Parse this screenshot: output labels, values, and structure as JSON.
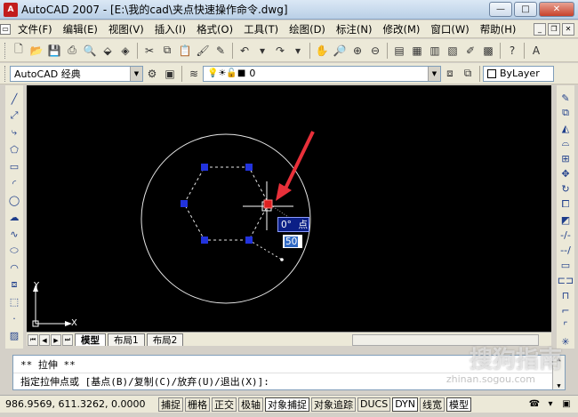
{
  "window": {
    "app_icon_text": "A",
    "title": "AutoCAD 2007 - [E:\\我的cad\\夹点快速操作命令.dwg]",
    "minimize": "—",
    "maximize": "□",
    "close": "✕"
  },
  "menu": {
    "items": [
      {
        "label": "文件(F)"
      },
      {
        "label": "编辑(E)"
      },
      {
        "label": "视图(V)"
      },
      {
        "label": "插入(I)"
      },
      {
        "label": "格式(O)"
      },
      {
        "label": "工具(T)"
      },
      {
        "label": "绘图(D)"
      },
      {
        "label": "标注(N)"
      },
      {
        "label": "修改(M)"
      },
      {
        "label": "窗口(W)"
      },
      {
        "label": "帮助(H)"
      }
    ],
    "mdi_min": "_",
    "mdi_restore": "❐",
    "mdi_close": "✕"
  },
  "toolbar2": {
    "workspace_value": "AutoCAD 经典",
    "layer_value": "0",
    "color_value": "ByLayer"
  },
  "canvas": {
    "dyn_angle": "0°",
    "dyn_point_hint": "点",
    "dyn_input_value": "50",
    "ucs_y": "Y",
    "ucs_x": "X"
  },
  "layout_tabs": [
    {
      "label": "模型",
      "active": true
    },
    {
      "label": "布局1",
      "active": false
    },
    {
      "label": "布局2",
      "active": false
    }
  ],
  "command": {
    "line1": "** 拉伸 **",
    "line2": "指定拉伸点或 [基点(B)/复制(C)/放弃(U)/退出(X)]:"
  },
  "status": {
    "coords": "986.9569,  611.3262, 0.0000",
    "buttons": [
      {
        "label": "捕捉",
        "on": false
      },
      {
        "label": "栅格",
        "on": false
      },
      {
        "label": "正交",
        "on": false
      },
      {
        "label": "极轴",
        "on": false
      },
      {
        "label": "对象捕捉",
        "on": true
      },
      {
        "label": "对象追踪",
        "on": false
      },
      {
        "label": "DUCS",
        "on": false
      },
      {
        "label": "DYN",
        "on": true
      },
      {
        "label": "线宽",
        "on": false
      },
      {
        "label": "模型",
        "on": true
      }
    ]
  },
  "watermark": {
    "brand": "搜狗指南",
    "url": "zhinan.sogou.com"
  },
  "colors": {
    "grip": "#2233dd",
    "hot_grip": "#e02020",
    "arrow": "#e8303a",
    "background": "#000000"
  }
}
